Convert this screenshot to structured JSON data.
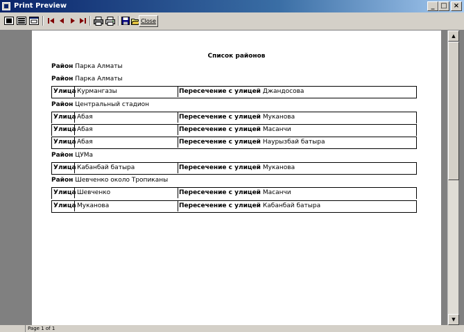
{
  "window": {
    "title": "Print Preview",
    "minimize_label": "_",
    "maximize_label": "□",
    "close_label": "×"
  },
  "toolbar": {
    "close_label": "Close"
  },
  "report": {
    "title": "Список районов",
    "rows": [
      {
        "kind": "district",
        "label": "Район",
        "value": "Парка Алматы"
      },
      {
        "kind": "district",
        "label": "Район",
        "value": "Парка Алматы"
      },
      {
        "kind": "street",
        "label": "Улица",
        "street": "Курмангазы",
        "cross_label": "Пересечение с улицей",
        "cross": "Джандосова"
      },
      {
        "kind": "district",
        "label": "Район",
        "value": "Центральный стадион"
      },
      {
        "kind": "street",
        "label": "Улица",
        "street": "Абая",
        "cross_label": "Пересечение с улицей",
        "cross": "Муканова"
      },
      {
        "kind": "street",
        "label": "Улица",
        "street": "Абая",
        "cross_label": "Пересечение с улицей",
        "cross": "Масанчи"
      },
      {
        "kind": "street",
        "label": "Улица",
        "street": "Абая",
        "cross_label": "Пересечение с улицей",
        "cross": "Наурызбай батыра"
      },
      {
        "kind": "district",
        "label": "Район",
        "value": "ЦУМа"
      },
      {
        "kind": "street",
        "label": "Улица",
        "street": "Кабанбай батыра",
        "cross_label": "Пересечение с улицей",
        "cross": "Муканова"
      },
      {
        "kind": "district",
        "label": "Район",
        "value": "Шевченко около Тропиканы"
      },
      {
        "kind": "street",
        "label": "Улица",
        "street": "Шевченко",
        "cross_label": "Пересечение с улицей",
        "cross": "Масанчи"
      },
      {
        "kind": "street",
        "label": "Улица",
        "street": "Муканова",
        "cross_label": "Пересечение с улицей",
        "cross": "Кабанбай батыра"
      }
    ]
  },
  "status": {
    "page_text": "Page 1 of 1"
  }
}
